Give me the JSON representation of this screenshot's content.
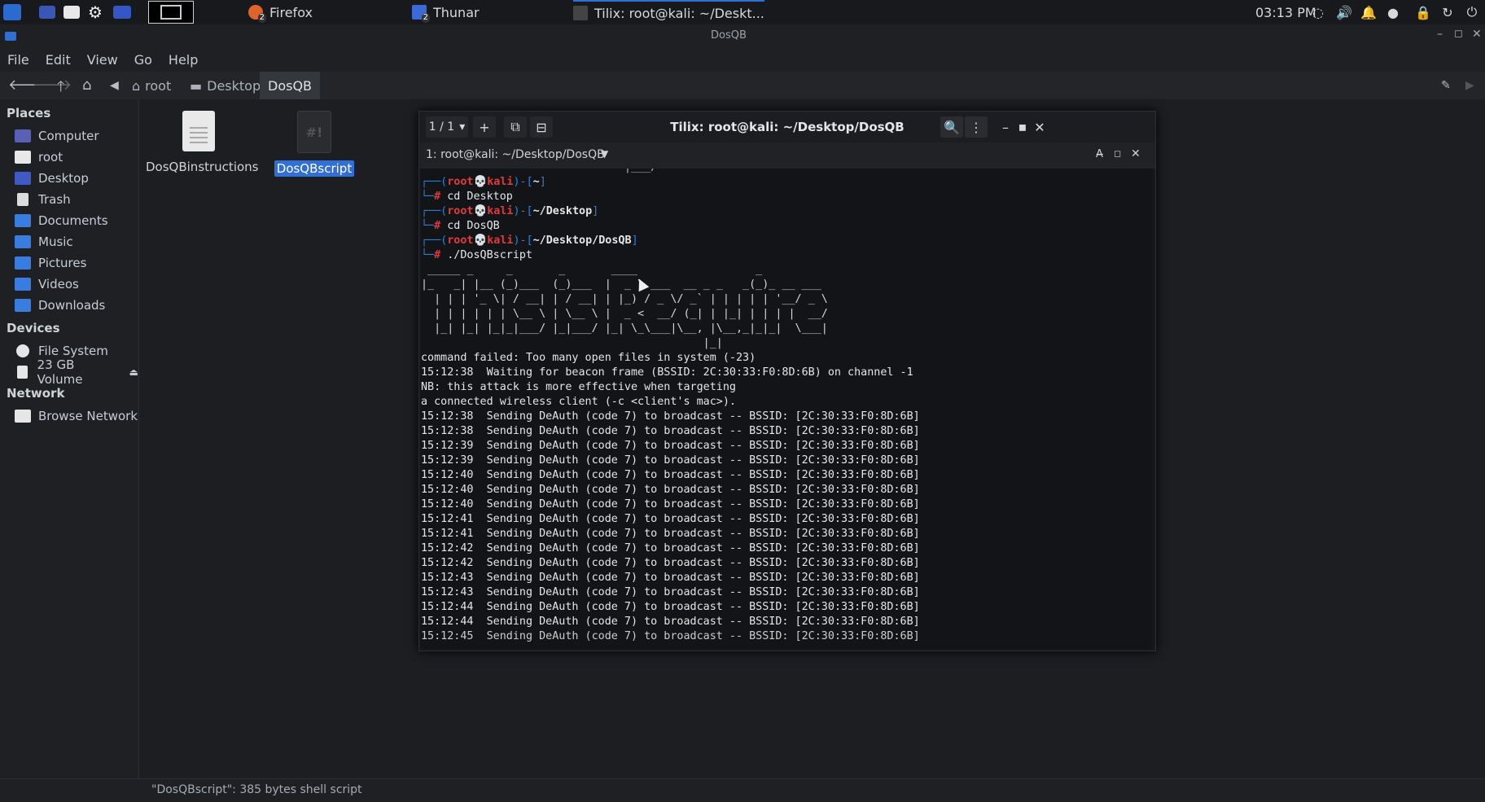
{
  "panel": {
    "tasks": [
      {
        "label": "Firefox",
        "badge": "2"
      },
      {
        "label": "Thunar",
        "badge": "2"
      },
      {
        "label": "Tilix: root@kali: ~/Deskt..."
      }
    ],
    "clock": "03:13 PM"
  },
  "thunar": {
    "title": "DosQB",
    "menu": [
      "File",
      "Edit",
      "View",
      "Go",
      "Help"
    ],
    "breadcrumb": [
      "root",
      "Desktop",
      "DosQB"
    ],
    "sidebar": {
      "places_header": "Places",
      "places": [
        "Computer",
        "root",
        "Desktop",
        "Trash",
        "Documents",
        "Music",
        "Pictures",
        "Videos",
        "Downloads"
      ],
      "devices_header": "Devices",
      "devices": [
        "File System",
        "23 GB Volume"
      ],
      "network_header": "Network",
      "network": [
        "Browse Network"
      ]
    },
    "files": [
      {
        "name": "DosQBinstructions"
      },
      {
        "name": "DosQBscript",
        "icon_text": "#!"
      }
    ],
    "status": "\"DosQBscript\": 385 bytes shell script"
  },
  "tilix": {
    "session": "1 / 1",
    "title": "Tilix: root@kali: ~/Desktop/DosQB",
    "tab_title": "1: root@kali: ~/Desktop/DosQB",
    "prompts": [
      {
        "user": "root",
        "host": "kali",
        "dir": "~",
        "cmd": "cd Desktop"
      },
      {
        "user": "root",
        "host": "kali",
        "dir": "~/Desktop",
        "cmd": "cd DosQB"
      },
      {
        "user": "root",
        "host": "kali",
        "dir": "~/Desktop/DosQB",
        "cmd": "./DosQBscript"
      }
    ],
    "banner": [
      " _____ _     _       _       ____                  _              ",
      "|_   _| |__ (_)___  (_)___  |  _ \\ ___  __ _ _   _(_)_ __ ___   ",
      "  | | | '_ \\| / __| | / __| | |_) / _ \\/ _` | | | | | '__/ _ \\  ",
      "  | | | | | | \\__ \\ | \\__ \\ |  _ <  __/ (_| | |_| | | | |  __/  ",
      "  |_| |_| |_|_|___/ |_|___/ |_| \\_\\___|\\__, |\\__,_|_|_|  \\___|  ",
      "                                           |_|                    "
    ],
    "output": [
      "command failed: Too many open files in system (-23)",
      "15:12:38  Waiting for beacon frame (BSSID: 2C:30:33:F0:8D:6B) on channel -1",
      "NB: this attack is more effective when targeting",
      "a connected wireless client (-c <client's mac>).",
      "15:12:38  Sending DeAuth (code 7) to broadcast -- BSSID: [2C:30:33:F0:8D:6B]",
      "15:12:38  Sending DeAuth (code 7) to broadcast -- BSSID: [2C:30:33:F0:8D:6B]",
      "15:12:39  Sending DeAuth (code 7) to broadcast -- BSSID: [2C:30:33:F0:8D:6B]",
      "15:12:39  Sending DeAuth (code 7) to broadcast -- BSSID: [2C:30:33:F0:8D:6B]",
      "15:12:40  Sending DeAuth (code 7) to broadcast -- BSSID: [2C:30:33:F0:8D:6B]",
      "15:12:40  Sending DeAuth (code 7) to broadcast -- BSSID: [2C:30:33:F0:8D:6B]",
      "15:12:40  Sending DeAuth (code 7) to broadcast -- BSSID: [2C:30:33:F0:8D:6B]",
      "15:12:41  Sending DeAuth (code 7) to broadcast -- BSSID: [2C:30:33:F0:8D:6B]",
      "15:12:41  Sending DeAuth (code 7) to broadcast -- BSSID: [2C:30:33:F0:8D:6B]",
      "15:12:42  Sending DeAuth (code 7) to broadcast -- BSSID: [2C:30:33:F0:8D:6B]",
      "15:12:42  Sending DeAuth (code 7) to broadcast -- BSSID: [2C:30:33:F0:8D:6B]",
      "15:12:43  Sending DeAuth (code 7) to broadcast -- BSSID: [2C:30:33:F0:8D:6B]",
      "15:12:43  Sending DeAuth (code 7) to broadcast -- BSSID: [2C:30:33:F0:8D:6B]",
      "15:12:44  Sending DeAuth (code 7) to broadcast -- BSSID: [2C:30:33:F0:8D:6B]",
      "15:12:44  Sending DeAuth (code 7) to broadcast -- BSSID: [2C:30:33:F0:8D:6B]"
    ]
  },
  "colors": {
    "accent": "#2f6fd6",
    "prompt_blue": "#2a7fd8",
    "prompt_red": "#e03a3a"
  }
}
